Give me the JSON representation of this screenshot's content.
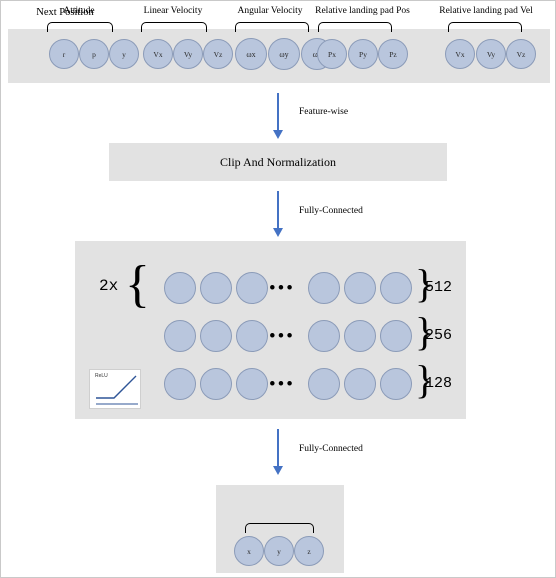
{
  "input_layer": {
    "groups": [
      {
        "label": "Attitude",
        "nodes": [
          "r",
          "p",
          "y"
        ]
      },
      {
        "label": "Linear Velocity",
        "nodes": [
          "Vx",
          "Vy",
          "Vz"
        ]
      },
      {
        "label": "Angular Velocity",
        "nodes": [
          "ωx",
          "ωy",
          "ωz"
        ]
      },
      {
        "label": "Relative landing pad Pos",
        "nodes": [
          "Px",
          "Py",
          "Pz"
        ]
      },
      {
        "label": "Relative landing pad Vel",
        "nodes": [
          "Vx",
          "Vy",
          "Vz"
        ]
      }
    ]
  },
  "arrows": {
    "feature_wise": "Feature-wise",
    "fully_connected_1": "Fully-Connected",
    "fully_connected_2": "Fully-Connected"
  },
  "clip_block": {
    "title": "Clip And Normalization"
  },
  "hidden_layers": {
    "multiplier": "2x",
    "dots": "•••",
    "rows": [
      {
        "size": "512"
      },
      {
        "size": "256"
      },
      {
        "size": "128"
      }
    ],
    "activation": {
      "name": "ReLU"
    }
  },
  "output_layer": {
    "title": "Next Position",
    "nodes": [
      "x",
      "y",
      "z"
    ]
  },
  "colors": {
    "panel": "#e2e2e2",
    "node_fill": "#b9c6dd",
    "node_stroke": "#8b9bb8",
    "arrow": "#4472c4",
    "relu_line": "#2f5597"
  }
}
